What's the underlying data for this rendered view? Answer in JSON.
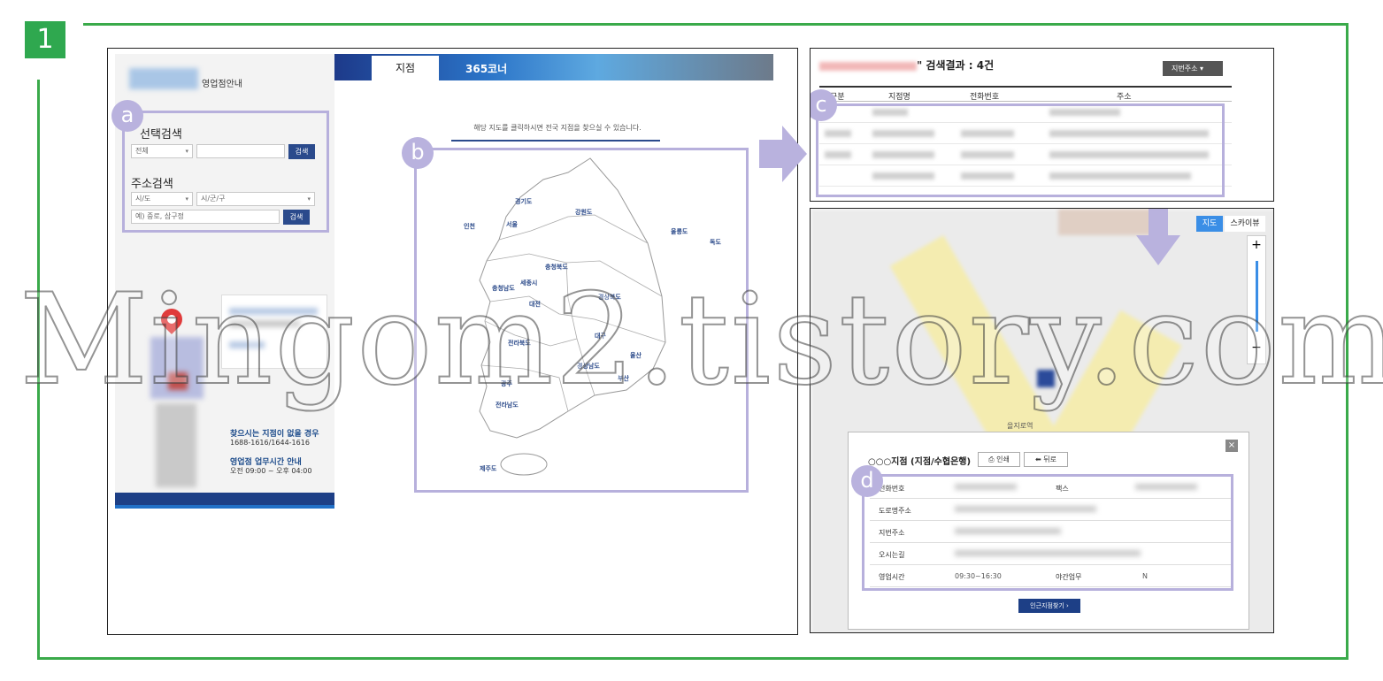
{
  "step_badge": "1",
  "left": {
    "logo_text": "영업점안내",
    "tabs": [
      {
        "label": "지점"
      },
      {
        "label": "365코너"
      }
    ],
    "select_search": {
      "title": "선택검색",
      "select_value": "전체",
      "button": "검색"
    },
    "address_search": {
      "title": "주소검색",
      "city_value": "시/도",
      "district_value": "시/군/구",
      "input_placeholder": "예) 중로, 삼구정",
      "button": "검색"
    },
    "help": {
      "title": "찾으시는 지점이 없을 경우",
      "phones": "1688-1616/1644-1616",
      "hours_title": "영업점 업무시간 안내",
      "hours": "오전 09:00 ~ 오후 04:00"
    },
    "map_hint": "해당 지도를 클릭하시면 전국 지점을 찾으실 수 있습니다.",
    "regions": [
      "경기도",
      "서울",
      "인천",
      "강원도",
      "충청북도",
      "세종시",
      "충청남도",
      "대전",
      "경상북도",
      "전라북도",
      "대구",
      "울산",
      "경상남도",
      "부산",
      "광주",
      "전라남도",
      "제주도",
      "울릉도",
      "독도"
    ]
  },
  "results": {
    "title_suffix": "\" 검색결과 : 4건",
    "sort_select": "지번주소",
    "headers": [
      "구분",
      "지점명",
      "전화번호",
      "주소"
    ]
  },
  "map": {
    "view_map": "지도",
    "view_sky": "스카이뷰",
    "zoom_in": "+",
    "zoom_out": "−",
    "station_label": "을지로역",
    "popup": {
      "title": "○○○지점 (지점/수협은행)",
      "print": "인쇄",
      "back": "뒤로",
      "close": "×",
      "rows": [
        {
          "label": "전화번호",
          "extra_label": "팩스"
        },
        {
          "label": "도로명주소"
        },
        {
          "label": "지번주소"
        },
        {
          "label": "오시는길"
        },
        {
          "label": "영업시간",
          "value": "09:30~16:30",
          "extra_label": "야간업무",
          "extra_value": "N"
        }
      ],
      "cta": "인근지점찾기 ›"
    }
  },
  "markers": [
    "a",
    "b",
    "c",
    "d"
  ],
  "watermark": "Mingom2.tistory.com",
  "colors": {
    "frame": "#3aaa4a",
    "highlight": "#b7b0dc",
    "brand": "#1d3f86"
  }
}
